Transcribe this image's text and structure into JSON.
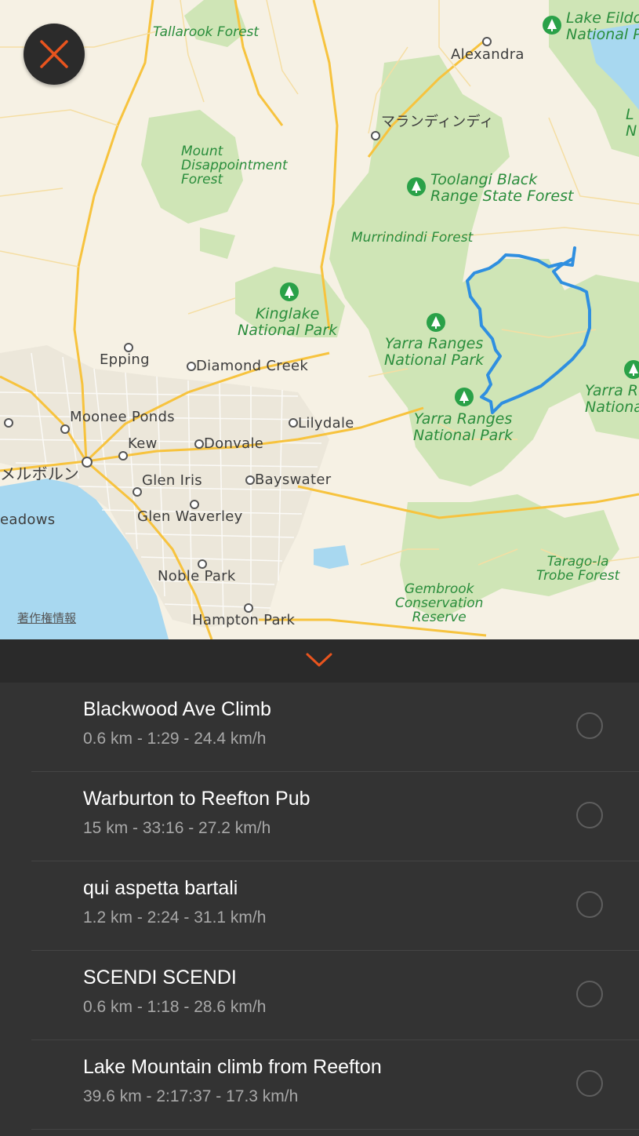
{
  "map": {
    "cities": {
      "alexandra": "Alexandra",
      "marysville": "マランディンディ",
      "epping": "Epping",
      "diamond_creek": "Diamond Creek",
      "moonee_ponds": "Moonee Ponds",
      "lilydale": "Lilydale",
      "kew": "Kew",
      "donvale": "Donvale",
      "melbourne": "メルボルン",
      "glen_iris": "Glen Iris",
      "bayswater": "Bayswater",
      "meadows": "eadows",
      "glen_waverley": "Glen Waverley",
      "noble_park": "Noble Park",
      "hampton_park": "Hampton Park"
    },
    "parks": {
      "tallarook": "Tallarook Forest",
      "mount_disappointment": "Mount\nDisappointment\nForest",
      "toolangi": "Toolangi Black\nRange State Forest",
      "murrindindi": "Murrindindi Forest",
      "kinglake": "Kinglake\nNational Park",
      "yarra_ranges_1": "Yarra Ranges\nNational Park",
      "yarra_ranges_2": "Yarra Ranges\nNational Park",
      "yarra_ranges_3": "Yarra R\nNationa",
      "lake_eildon": "Lake Eildo\nNational P",
      "lake_eildon_edge": "L\nN",
      "tarago": "Tarago-la\nTrobe Forest",
      "gembrook": "Gembrook\nConservation\nReserve"
    },
    "attribution": "著作権情報",
    "route_color": "#2f8fe0"
  },
  "close_button": {
    "icon": "close-icon",
    "color": "#e8541e"
  },
  "panel": {
    "collapse_icon": "chevron-down-icon"
  },
  "segments": [
    {
      "name": "Blackwood Ave Climb",
      "stats": "0.6 km - 1:29 - 24.4 km/h"
    },
    {
      "name": "Warburton to Reefton Pub",
      "stats": "15 km - 33:16 - 27.2 km/h"
    },
    {
      "name": "qui aspetta bartali",
      "stats": "1.2 km - 2:24 - 31.1 km/h"
    },
    {
      "name": "SCENDI SCENDI",
      "stats": "0.6 km - 1:18 - 28.6 km/h"
    },
    {
      "name": "Lake Mountain climb from Reefton",
      "stats": "39.6 km - 2:17:37 - 17.3 km/h"
    }
  ]
}
